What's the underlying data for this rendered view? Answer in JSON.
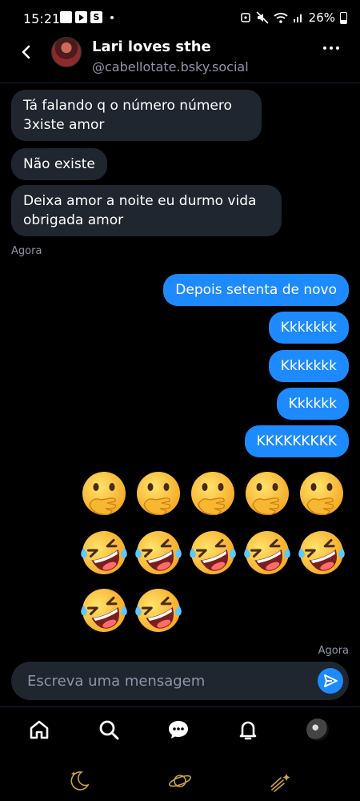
{
  "status_bar": {
    "time": "15:21",
    "battery": "26%",
    "icons": [
      "gallery-icon",
      "youtube-icon",
      "s-app-icon",
      "alarm-icon",
      "mute-icon",
      "wifi-icon",
      "signal-icon",
      "battery-icon"
    ],
    "s_glyph": "S"
  },
  "header": {
    "name": "Lari loves sthe",
    "handle": "@cabellotate.bsky.social"
  },
  "messages": {
    "in1": "Tá falando q o número número 3xiste amor",
    "in2": "Não existe",
    "in3": "Deixa amor a noite eu durmo vida obrigada amor",
    "in_time": "Agora",
    "out1": "Depois setenta de novo",
    "out2": "Kkkkkkk",
    "out3": "Kkkkkkk",
    "out4": "Kkkkkk",
    "out5": "KKKKKKKKK",
    "out_time": "Agora"
  },
  "emoji_rows": [
    [
      "hand-over-mouth",
      "hand-over-mouth",
      "hand-over-mouth",
      "hand-over-mouth",
      "hand-over-mouth"
    ],
    [
      "rolling-laughing",
      "rolling-laughing",
      "rolling-laughing",
      "rolling-laughing",
      "rolling-laughing"
    ],
    [
      "rolling-laughing",
      "rolling-laughing"
    ]
  ],
  "composer": {
    "placeholder": "Escreva uma mensagem"
  },
  "bottom_nav": [
    "home",
    "search",
    "messages",
    "notifications",
    "profile"
  ],
  "colors": {
    "accent": "#1e8aff",
    "bubble_incoming": "#1f2630",
    "muted_text": "#8b96a8",
    "background": "#000000"
  }
}
